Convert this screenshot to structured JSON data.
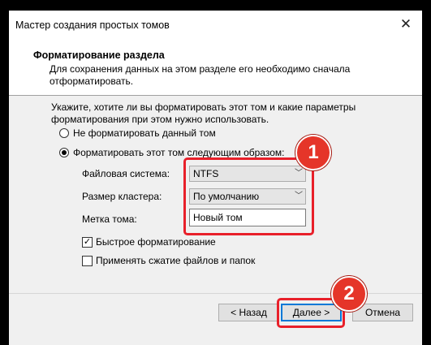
{
  "window": {
    "title": "Мастер создания простых томов"
  },
  "header": {
    "title": "Форматирование раздела",
    "subtitle": "Для сохранения данных на этом разделе его необходимо сначала отформатировать."
  },
  "intro": "Укажите, хотите ли вы форматировать этот том и какие параметры форматирования при этом нужно использовать.",
  "options": {
    "no_format": "Не форматировать данный том",
    "format": "Форматировать этот том следующим образом:"
  },
  "fields": {
    "fs_label": "Файловая система:",
    "fs_value": "NTFS",
    "cluster_label": "Размер кластера:",
    "cluster_value": "По умолчанию",
    "volume_label": "Метка тома:",
    "volume_value": "Новый том"
  },
  "checks": {
    "quick": "Быстрое форматирование",
    "compress": "Применять сжатие файлов и папок"
  },
  "buttons": {
    "back": "< Назад",
    "next": "Далее >",
    "cancel": "Отмена"
  },
  "badges": {
    "one": "1",
    "two": "2"
  },
  "colors": {
    "highlight": "#e8202a",
    "badge": "#e53529"
  }
}
